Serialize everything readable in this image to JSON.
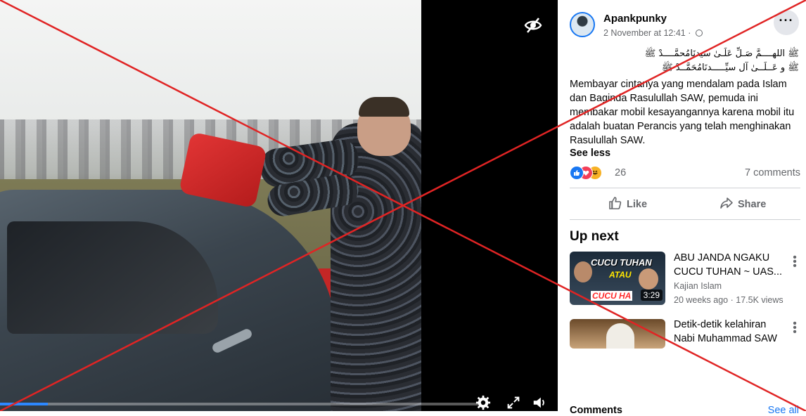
{
  "post": {
    "author": "Apankpunky",
    "date": "2 November at 12:41",
    "separator": "·",
    "arabic_line1": "ﷺ اللهــــمَّ صَـلِّ عَلَـىٰ سيدنَامُحمَّــــدْ ﷺ",
    "arabic_line2": "ﷺ و عَــلَــىٰ آل سيِّـــــدنَامُحَمَّــدْ ﷺ",
    "text": "Membayar cintanya yang mendalam pada Islam dan Baginda Rasulullah SAW, pemuda ini membakar mobil kesayangannya karena mobil itu adalah buatan Perancis yang telah menghinakan Rasulullah SAW.",
    "see_less": "See less",
    "reactions_count": "26",
    "comments_count": "7 comments",
    "more_icon": "···"
  },
  "actions": {
    "like": "Like",
    "share": "Share"
  },
  "up_next": {
    "heading": "Up next",
    "videos": [
      {
        "title": "ABU JANDA NGAKU CUCU TUHAN ~ UAS...",
        "channel": "Kajian Islam",
        "stats": "20 weeks ago · 17.5K views",
        "duration": "3:29",
        "thumb_text1": "CUCU TUHAN",
        "thumb_text2": "ATAU",
        "thumb_text3": "CUCU HA"
      },
      {
        "title": "Detik-detik kelahiran Nabi Muhammad SAW"
      }
    ]
  },
  "comments": {
    "heading": "Comments",
    "see_all": "See all"
  },
  "video": {
    "progress": 0.1
  },
  "icons": {
    "hidden": "eye-slash-icon",
    "settings": "gear-icon",
    "fullscreen": "expand-icon",
    "volume": "speaker-icon",
    "like": "thumbs-up-icon",
    "share": "share-arrow-icon",
    "privacy": "globe-icon",
    "reaction_like": "like-reaction-icon",
    "reaction_love": "love-reaction-icon",
    "reaction_haha": "haha-reaction-icon"
  },
  "colors": {
    "accent": "#1877f2",
    "cross": "#e02424",
    "progress": "#2d88ff"
  }
}
